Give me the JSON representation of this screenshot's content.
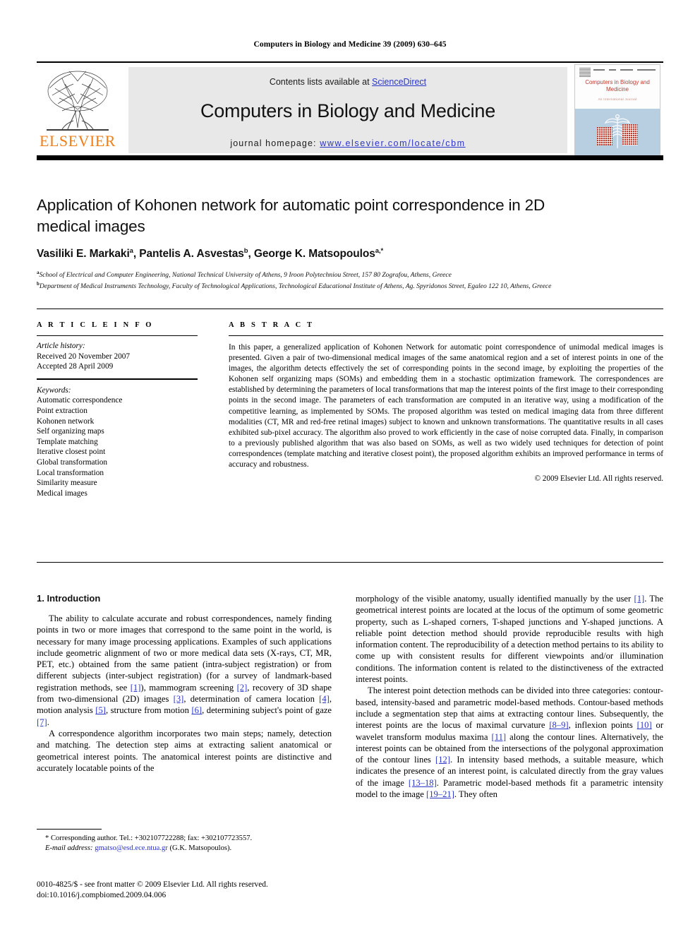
{
  "running_head": "Computers in Biology and Medicine 39 (2009) 630–645",
  "masthead": {
    "contents_prefix": "Contents lists available at ",
    "sciencedirect": "ScienceDirect",
    "journal_name": "Computers in Biology and Medicine",
    "homepage_prefix": "journal homepage: ",
    "homepage_url": "www.elsevier.com/locate/cbm",
    "publisher_wordmark": "ELSEVIER",
    "link_color": "#2b35c8",
    "elsevier_orange": "#F07F1A",
    "band_color": "#e8e8e8",
    "cover": {
      "title": "Computers in Biology and Medicine",
      "subtitle": "An International Journal",
      "title_color": "#c0392b",
      "panel_color": "#b8cfe2"
    }
  },
  "article": {
    "title": "Application of Kohonen network for automatic point correspondence in 2D medical images",
    "authors_html": "Vasiliki E. Markaki<sup>a</sup>, Pantelis A. Asvestas<sup>b</sup>, George K. Matsopoulos<sup>a,</sup><sup>*</sup>",
    "affiliation_a": "School of Electrical and Computer Engineering, National Technical University of Athens, 9 Iroon Polytechniou Street, 157 80 Zografou, Athens, Greece",
    "affiliation_b": "Department of Medical Instruments Technology, Faculty of Technological Applications, Technological Educational Institute of Athens, Ag. Spyridonos Street, Egaleo 122 10, Athens, Greece"
  },
  "article_info": {
    "heading": "A R T I C L E   I N F O",
    "history_label": "Article history:",
    "received": "Received 20 November 2007",
    "accepted": "Accepted 28 April 2009",
    "keywords_label": "Keywords:",
    "keywords": [
      "Automatic correspondence",
      "Point extraction",
      "Kohonen network",
      "Self organizing maps",
      "Template matching",
      "Iterative closest point",
      "Global transformation",
      "Local transformation",
      "Similarity measure",
      "Medical images"
    ]
  },
  "abstract": {
    "heading": "A B S T R A C T",
    "text": "In this paper, a generalized application of Kohonen Network for automatic point correspondence of unimodal medical images is presented. Given a pair of two-dimensional medical images of the same anatomical region and a set of interest points in one of the images, the algorithm detects effectively the set of corresponding points in the second image, by exploiting the properties of the Kohonen self organizing maps (SOMs) and embedding them in a stochastic optimization framework. The correspondences are established by determining the parameters of local transformations that map the interest points of the first image to their corresponding points in the second image. The parameters of each transformation are computed in an iterative way, using a modification of the competitive learning, as implemented by SOMs. The proposed algorithm was tested on medical imaging data from three different modalities (CT, MR and red-free retinal images) subject to known and unknown transformations. The quantitative results in all cases exhibited sub-pixel accuracy. The algorithm also proved to work efficiently in the case of noise corrupted data. Finally, in comparison to a previously published algorithm that was also based on SOMs, as well as two widely used techniques for detection of point correspondences (template matching and iterative closest point), the proposed algorithm exhibits an improved performance in terms of accuracy and robustness.",
    "copyright": "© 2009 Elsevier Ltd. All rights reserved."
  },
  "body": {
    "section_heading": "1. Introduction",
    "left_p1_a": "The ability to calculate accurate and robust correspondences, namely finding points in two or more images that correspond to the same point in the world, is necessary for many image processing applications. Examples of such applications include geometric alignment of two or more medical data sets (X-rays, CT, MR, PET, etc.) obtained from the same patient (intra-subject registration) or from different subjects (inter-subject registration) (for a survey of landmark-based registration methods, see ",
    "left_p1_r1": "[1]",
    "left_p1_b": "), mammogram screening ",
    "left_p1_r2": "[2]",
    "left_p1_c": ", recovery of 3D shape from two-dimensional (2D) images ",
    "left_p1_r3": "[3]",
    "left_p1_d": ", determination of camera location ",
    "left_p1_r4": "[4]",
    "left_p1_e": ", motion analysis ",
    "left_p1_r5": "[5]",
    "left_p1_f": ", structure from motion ",
    "left_p1_r6": "[6]",
    "left_p1_g": ", determining subject's point of gaze ",
    "left_p1_r7": "[7]",
    "left_p1_h": ".",
    "left_p2": "A correspondence algorithm incorporates two main steps; namely, detection and matching. The detection step aims at extracting salient anatomical or geometrical interest points. The anatomical interest points are distinctive and accurately locatable points of the",
    "right_p1_a": "morphology of the visible anatomy, usually identified manually by the user ",
    "right_p1_r1": "[1]",
    "right_p1_b": ". The geometrical interest points are located at the locus of the optimum of some geometric property, such as L-shaped corners, T-shaped junctions and Y-shaped junctions. A reliable point detection method should provide reproducible results with high information content. The reproducibility of a detection method pertains to its ability to come up with consistent results for different viewpoints and/or illumination conditions. The information content is related to the distinctiveness of the extracted interest points.",
    "right_p2_a": "The interest point detection methods can be divided into three categories: contour-based, intensity-based and parametric model-based methods. Contour-based methods include a segmentation step that aims at extracting contour lines. Subsequently, the interest points are the locus of maximal curvature ",
    "right_p2_r1": "[8–9]",
    "right_p2_b": ", inflexion points ",
    "right_p2_r2": "[10]",
    "right_p2_c": " or wavelet transform modulus maxima ",
    "right_p2_r3": "[11]",
    "right_p2_d": " along the contour lines. Alternatively, the interest points can be obtained from the intersections of the polygonal approximation of the contour lines ",
    "right_p2_r4": "[12]",
    "right_p2_e": ". In intensity based methods, a suitable measure, which indicates the presence of an interest point, is calculated directly from the gray values of the image ",
    "right_p2_r5": "[13–18]",
    "right_p2_f": ". Parametric model-based methods fit a parametric intensity model to the image ",
    "right_p2_r6": "[19–21]",
    "right_p2_g": ". They often"
  },
  "footer": {
    "corresponding": "* Corresponding author. Tel.: +302107722288; fax: +302107723557.",
    "email_label": "E-mail address:",
    "email": "gmatso@esd.ece.ntua.gr",
    "email_owner": "(G.K. Matsopoulos).",
    "issn_line": "0010-4825/$ - see front matter © 2009 Elsevier Ltd. All rights reserved.",
    "doi_line": "doi:10.1016/j.compbiomed.2009.04.006"
  }
}
